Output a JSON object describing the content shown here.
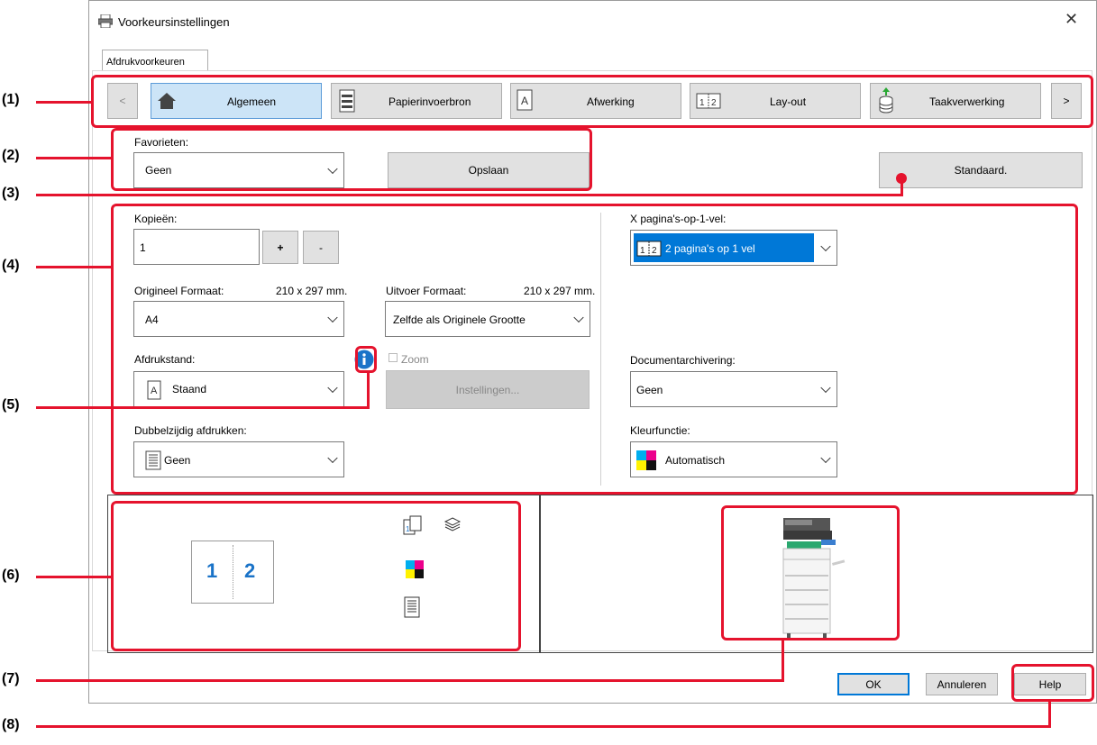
{
  "window": {
    "title": "Voorkeursinstellingen",
    "tab": "Afdrukvoorkeuren"
  },
  "nav": {
    "prev": "<",
    "next": ">",
    "tabs": [
      {
        "label": "Algemeen",
        "icon": "home-icon",
        "selected": true
      },
      {
        "label": "Papierinvoerbron",
        "icon": "paper-tray-icon"
      },
      {
        "label": "Afwerking",
        "icon": "finishing-icon"
      },
      {
        "label": "Lay-out",
        "icon": "layout-icon"
      },
      {
        "label": "Taakverwerking",
        "icon": "job-handling-icon"
      }
    ]
  },
  "favorites": {
    "label": "Favorieten:",
    "value": "Geen",
    "save": "Opslaan"
  },
  "default_button": "Standaard.",
  "copies": {
    "label": "Kopieën:",
    "value": "1",
    "plus": "+",
    "minus": "-"
  },
  "original_size": {
    "label": "Origineel Formaat:",
    "dims": "210 x 297 mm.",
    "value": "A4"
  },
  "output_size": {
    "label": "Uitvoer Formaat:",
    "dims": "210 x 297 mm.",
    "value": "Zelfde als Originele Grootte"
  },
  "orientation": {
    "label": "Afdrukstand:",
    "value": "Staand"
  },
  "zoom": {
    "label": "Zoom",
    "settings": "Instellingen..."
  },
  "duplex": {
    "label": "Dubbelzijdig afdrukken:",
    "value": "Geen"
  },
  "nup": {
    "label": "X pagina's-op-1-vel:",
    "value": "2 pagina's op 1 vel"
  },
  "doc_filing": {
    "label": "Documentarchivering:",
    "value": "Geen"
  },
  "color": {
    "label": "Kleurfunctie:",
    "value": "Automatisch"
  },
  "preview": {
    "page1": "1",
    "page2": "2"
  },
  "footer": {
    "ok": "OK",
    "cancel": "Annuleren",
    "help": "Help"
  },
  "callouts": [
    "(1)",
    "(2)",
    "(3)",
    "(4)",
    "(5)",
    "(6)",
    "(7)",
    "(8)"
  ],
  "colors": {
    "accent": "#e5132d",
    "selection": "#0078d7",
    "info": "#1a73c8"
  }
}
